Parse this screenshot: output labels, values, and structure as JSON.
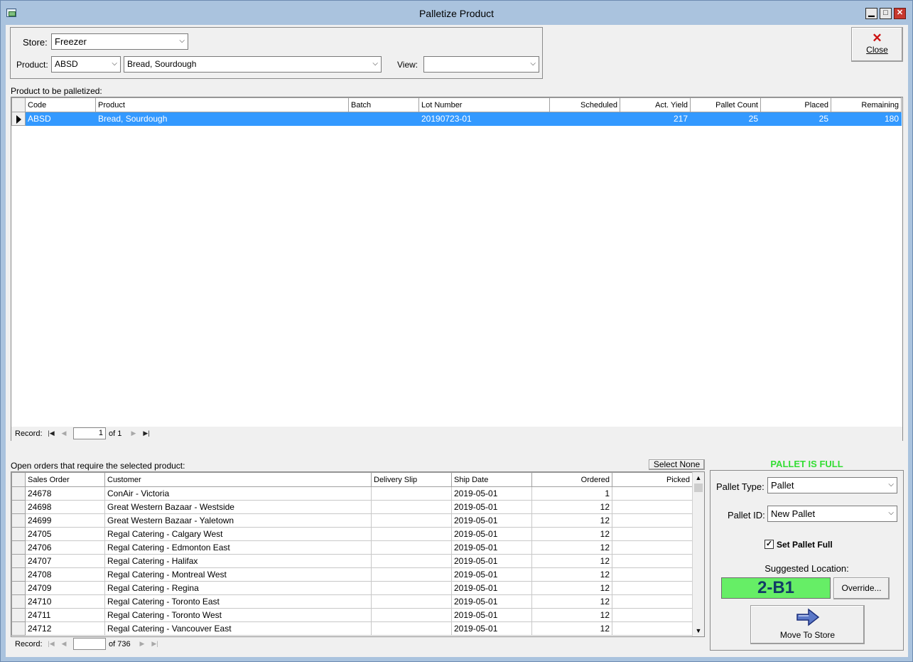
{
  "window": {
    "title": "Palletize Product",
    "minimize_label": "▁",
    "maximize_label": "□",
    "close_label": "✕"
  },
  "close_button": {
    "icon": "close-x-icon",
    "label": "Close"
  },
  "filters": {
    "store_label": "Store:",
    "store_value": "Freezer",
    "product_label": "Product:",
    "product_code": "ABSD",
    "product_name": "Bread, Sourdough",
    "view_label": "View:",
    "view_value": ""
  },
  "products": {
    "section_label": "Product to be palletized:",
    "columns": [
      "Code",
      "Product",
      "Batch",
      "Lot Number",
      "Scheduled",
      "Act. Yield",
      "Pallet Count",
      "Placed",
      "Remaining"
    ],
    "rows": [
      [
        "ABSD",
        "Bread, Sourdough",
        "",
        "20190723-01",
        "",
        "217",
        "25",
        "25",
        "180"
      ]
    ],
    "nav": {
      "record_label": "Record:",
      "current": "1",
      "of_text": "of 1"
    }
  },
  "orders": {
    "section_label": "Open orders that require the selected product:",
    "select_none_label": "Select None",
    "columns": [
      "Sales Order",
      "Customer",
      "Delivery Slip",
      "Ship Date",
      "Ordered",
      "Picked"
    ],
    "rows": [
      [
        "24678",
        "ConAir - Victoria",
        "",
        "2019-05-01",
        "1",
        ""
      ],
      [
        "24698",
        "Great Western Bazaar - Westside",
        "",
        "2019-05-01",
        "12",
        ""
      ],
      [
        "24699",
        "Great Western Bazaar - Yaletown",
        "",
        "2019-05-01",
        "12",
        ""
      ],
      [
        "24705",
        "Regal Catering - Calgary West",
        "",
        "2019-05-01",
        "12",
        ""
      ],
      [
        "24706",
        "Regal Catering - Edmonton East",
        "",
        "2019-05-01",
        "12",
        ""
      ],
      [
        "24707",
        "Regal Catering - Halifax",
        "",
        "2019-05-01",
        "12",
        ""
      ],
      [
        "24708",
        "Regal Catering - Montreal West",
        "",
        "2019-05-01",
        "12",
        ""
      ],
      [
        "24709",
        "Regal Catering - Regina",
        "",
        "2019-05-01",
        "12",
        ""
      ],
      [
        "24710",
        "Regal Catering - Toronto East",
        "",
        "2019-05-01",
        "12",
        ""
      ],
      [
        "24711",
        "Regal Catering - Toronto West",
        "",
        "2019-05-01",
        "12",
        ""
      ],
      [
        "24712",
        "Regal Catering - Vancouver East",
        "",
        "2019-05-01",
        "12",
        ""
      ]
    ],
    "nav": {
      "record_label": "Record:",
      "current": "",
      "of_text": "of 736"
    }
  },
  "pallet": {
    "status": "PALLET IS FULL",
    "status_color": "#33dd33",
    "type_label": "Pallet Type:",
    "type_value": "Pallet",
    "id_label": "Pallet ID:",
    "id_value": "New Pallet",
    "set_full_label": "Set Pallet Full",
    "set_full_checked": true,
    "suggested_label": "Suggested Location:",
    "suggested_value": "2-B1",
    "override_label": "Override...",
    "move_label": "Move To Store",
    "move_icon": "right-arrow-icon"
  }
}
